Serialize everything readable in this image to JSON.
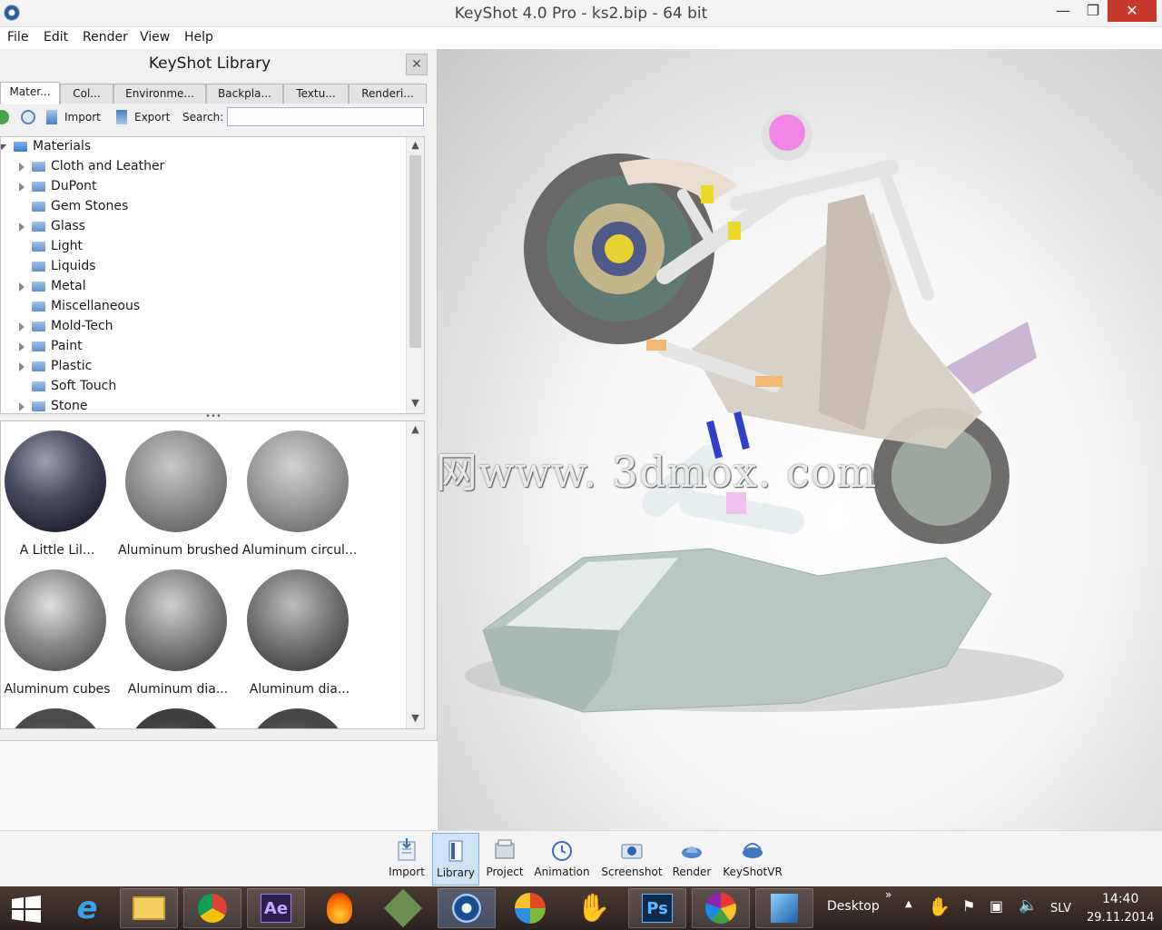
{
  "window": {
    "title": "KeyShot 4.0 Pro  - ks2.bip  - 64 bit",
    "minimize": "—",
    "maximize": "❐",
    "close": "✕"
  },
  "menu": [
    "File",
    "Edit",
    "Render",
    "View",
    "Help"
  ],
  "library": {
    "title": "KeyShot Library",
    "close": "✕",
    "tabs": [
      "Mater...",
      "Col...",
      "Environme...",
      "Backpla...",
      "Textu...",
      "Renderi..."
    ],
    "active_tab": "Mater...",
    "toolbar": {
      "import_label": "Import",
      "export_label": "Export",
      "search_label": "Search:",
      "search_value": ""
    },
    "tree": {
      "root": "Materials",
      "items": [
        {
          "label": "Cloth and Leather",
          "expandable": true
        },
        {
          "label": "DuPont",
          "expandable": true
        },
        {
          "label": "Gem Stones",
          "expandable": false
        },
        {
          "label": "Glass",
          "expandable": true
        },
        {
          "label": "Light",
          "expandable": false
        },
        {
          "label": "Liquids",
          "expandable": false
        },
        {
          "label": "Metal",
          "expandable": true
        },
        {
          "label": "Miscellaneous",
          "expandable": false
        },
        {
          "label": "Mold-Tech",
          "expandable": true
        },
        {
          "label": "Paint",
          "expandable": true
        },
        {
          "label": "Plastic",
          "expandable": true
        },
        {
          "label": "Soft Touch",
          "expandable": false
        },
        {
          "label": "Stone",
          "expandable": true
        }
      ]
    },
    "splitter": "•••",
    "thumbnails": [
      {
        "label": "A Little Lil..."
      },
      {
        "label": "Aluminum brushed"
      },
      {
        "label": "Aluminum circul..."
      },
      {
        "label": "Aluminum cubes"
      },
      {
        "label": "Aluminum dia..."
      },
      {
        "label": "Aluminum dia..."
      }
    ]
  },
  "watermark": "莫西网www. 3dmox. com",
  "ribbon": [
    {
      "label": "Import",
      "icon": "import-icon"
    },
    {
      "label": "Library",
      "icon": "library-icon",
      "active": true
    },
    {
      "label": "Project",
      "icon": "project-icon"
    },
    {
      "label": "Animation",
      "icon": "animation-icon"
    },
    {
      "label": "Screenshot",
      "icon": "screenshot-icon"
    },
    {
      "label": "Render",
      "icon": "render-icon"
    },
    {
      "label": "KeyShotVR",
      "icon": "keyshotvr-icon"
    }
  ],
  "taskbar": {
    "desktop_label": "Desktop",
    "chevron": "»",
    "language": "SLV",
    "time": "14:40",
    "date": "29.11.2014",
    "ae_label": "Ae",
    "ps_label": "Ps"
  }
}
